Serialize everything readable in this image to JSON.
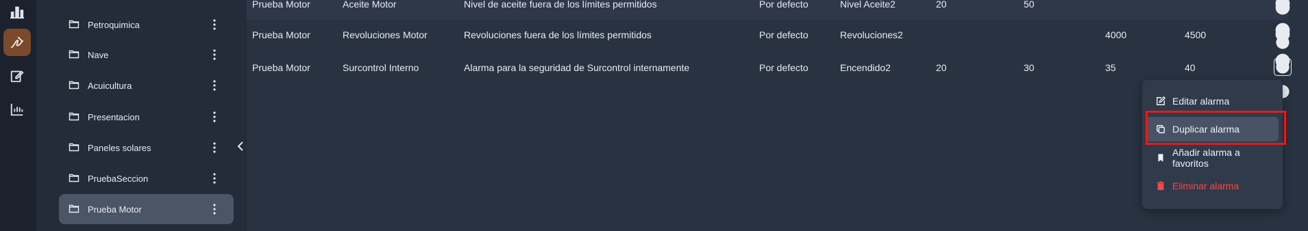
{
  "rail": {
    "icons": [
      "buildings-icon",
      "signature-icon",
      "edit-note-icon",
      "bar-chart-icon"
    ],
    "active_index": 1
  },
  "sidebar": {
    "items": [
      {
        "label": "Petroquimica"
      },
      {
        "label": "Nave"
      },
      {
        "label": "Acuicultura"
      },
      {
        "label": "Presentacion"
      },
      {
        "label": "Paneles solares"
      },
      {
        "label": "PruebaSeccion"
      },
      {
        "label": "Prueba Motor",
        "selected": true
      }
    ]
  },
  "table": {
    "rows": [
      {
        "seccion": "Prueba Motor",
        "nombre": "Aceite Motor",
        "descripcion": "Nivel de aceite fuera de los límites permitidos",
        "tipo": "Por defecto",
        "variable": "Nivel Aceite2",
        "v1": "20",
        "v2": "50",
        "v3": "",
        "v4": ""
      },
      {
        "seccion": "Prueba Motor",
        "nombre": "Revoluciones Motor",
        "descripcion": "Revoluciones fuera de los límites permitidos",
        "tipo": "Por defecto",
        "variable": "Revoluciones2",
        "v1": "",
        "v2": "",
        "v3": "4000",
        "v4": "4500"
      },
      {
        "seccion": "Prueba Motor",
        "nombre": "Surcontrol Interno",
        "descripcion": "Alarma para la seguridad de Surcontrol internamente",
        "tipo": "Por defecto",
        "variable": "Encendido2",
        "v1": "20",
        "v2": "30",
        "v3": "35",
        "v4": "40"
      }
    ]
  },
  "context_menu": {
    "items": [
      {
        "label": "Editar alarma",
        "icon": "edit-icon"
      },
      {
        "label": "Duplicar alarma",
        "icon": "duplicate-icon",
        "hovered": true
      },
      {
        "label": "Añadir alarma a favoritos",
        "icon": "bookmark-icon"
      },
      {
        "label": "Eliminar alarma",
        "icon": "trash-icon",
        "danger": true
      }
    ]
  },
  "colors": {
    "accent": "#7a4a2a",
    "danger": "#ef4b4b",
    "highlight": "#e01e1e"
  }
}
